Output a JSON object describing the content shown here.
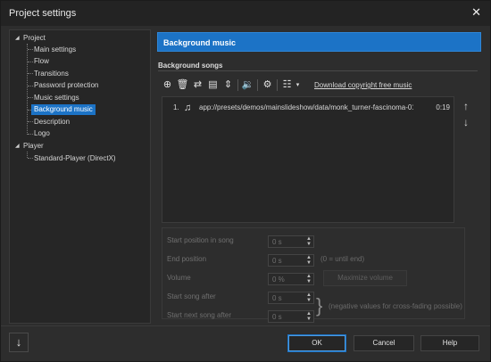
{
  "window": {
    "title": "Project settings",
    "close": "✕"
  },
  "tree": {
    "project": "Project",
    "items": [
      "Main settings",
      "Flow",
      "Transitions",
      "Password protection",
      "Music settings",
      "Background music",
      "Description",
      "Logo"
    ],
    "selected": "Background music",
    "player": "Player",
    "player_items": [
      "Standard-Player (DirectX)"
    ]
  },
  "panel": {
    "header": "Background music",
    "section": "Background songs",
    "toolbar": {
      "icons": [
        "add-icon",
        "delete-icon",
        "replace-icon",
        "edit-icon",
        "sort-icon",
        "volume-icon",
        "settings-icon",
        "list-options-icon"
      ],
      "dropdown_arrow": "▾",
      "download_link": "Download copyright free music"
    },
    "songs": [
      {
        "number": "1.",
        "path": "app://presets/demos/mainslideshow/data/monk_turner-fascinoma-01-",
        "duration": "0:19"
      }
    ],
    "move_up": "↑",
    "move_down": "↓"
  },
  "props": {
    "start_position": {
      "label": "Start position in song",
      "value": "0 s"
    },
    "end_position": {
      "label": "End position",
      "value": "0 s",
      "note": "(0 = until end)"
    },
    "volume": {
      "label": "Volume",
      "value": "0 %",
      "button": "Maximize volume"
    },
    "start_song_after": {
      "label": "Start song after",
      "value": "0 s"
    },
    "start_next_after": {
      "label": "Start next song after",
      "value": "0 s"
    },
    "crossfade_note": "(negative values for cross-fading possible)"
  },
  "footer": {
    "ok": "OK",
    "cancel": "Cancel",
    "help": "Help",
    "down": "↓"
  },
  "colors": {
    "accent": "#1c73c6",
    "background": "#2d2d2d"
  }
}
